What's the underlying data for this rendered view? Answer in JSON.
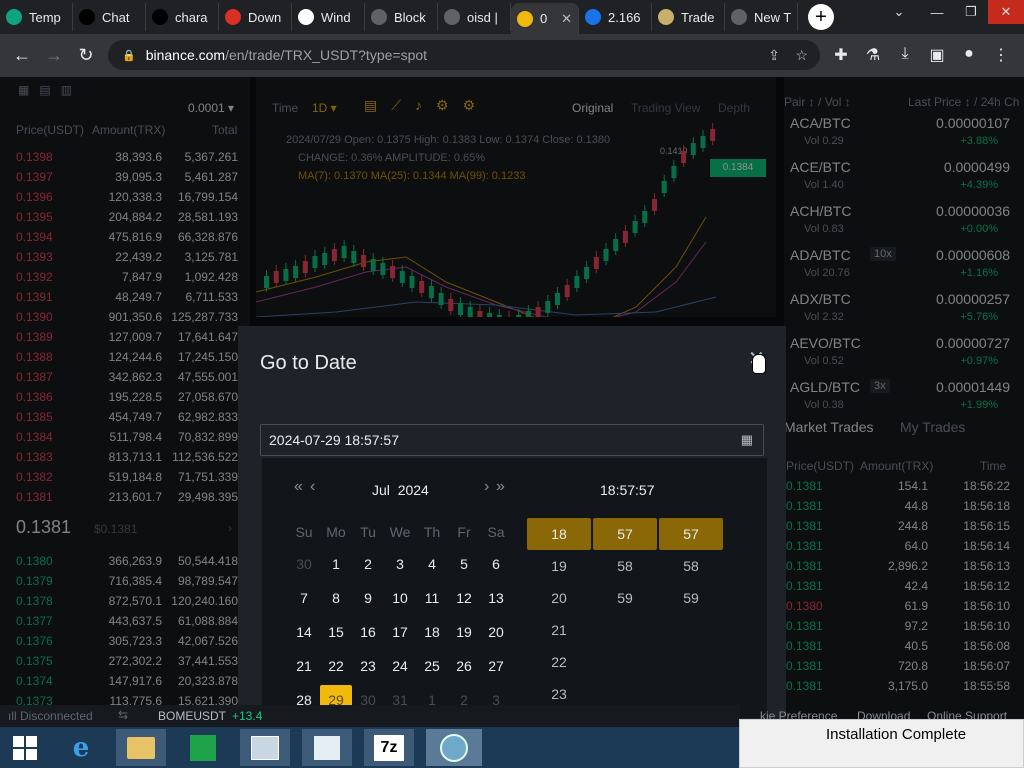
{
  "browser": {
    "tabs": [
      {
        "label": "Temp",
        "icon": "chatgpt-icon",
        "color": "#10a37f"
      },
      {
        "label": "Chat",
        "icon": "character-ai-icon",
        "color": "#000000"
      },
      {
        "label": "chara",
        "icon": "character-ai-icon",
        "color": "#000000"
      },
      {
        "label": "Down",
        "icon": "pdf-icon",
        "color": "#d93025"
      },
      {
        "label": "Wind",
        "icon": "windows-icon",
        "color": "#ffffff"
      },
      {
        "label": "Block",
        "icon": "globe-icon",
        "color": "#5f6368"
      },
      {
        "label": "oisd |",
        "icon": "globe-icon",
        "color": "#5f6368"
      },
      {
        "label": "0",
        "icon": "binance-icon",
        "color": "#f0b90b"
      },
      {
        "label": "2.166",
        "icon": "cloud-icon",
        "color": "#1a73e8"
      },
      {
        "label": "Trade",
        "icon": "trade-icon",
        "color": "#c8b06a"
      },
      {
        "label": "New T",
        "icon": "chrome-icon",
        "color": "#5f6368"
      }
    ],
    "url_host": "binance.com",
    "url_path": "/en/trade/TRX_USDT?type=spot"
  },
  "orderbook": {
    "precision": "0.0001",
    "headers": [
      "Price(USDT)",
      "Amount(TRX)",
      "Total"
    ],
    "asks": [
      [
        "0.1398",
        "38,393.6",
        "5,367.261"
      ],
      [
        "0.1397",
        "39,095.3",
        "5,461.287"
      ],
      [
        "0.1396",
        "120,338.3",
        "16,799.154"
      ],
      [
        "0.1395",
        "204,884.2",
        "28,581.193"
      ],
      [
        "0.1394",
        "475,816.9",
        "66,328.876"
      ],
      [
        "0.1393",
        "22,439.2",
        "3,125.781"
      ],
      [
        "0.1392",
        "7,847.9",
        "1,092.428"
      ],
      [
        "0.1391",
        "48,249.7",
        "6,711.533"
      ],
      [
        "0.1390",
        "901,350.6",
        "125,287.733"
      ],
      [
        "0.1389",
        "127,009.7",
        "17,641.647"
      ],
      [
        "0.1388",
        "124,244.6",
        "17,245.150"
      ],
      [
        "0.1387",
        "342,862.3",
        "47,555.001"
      ],
      [
        "0.1386",
        "195,228.5",
        "27,058.670"
      ],
      [
        "0.1385",
        "454,749.7",
        "62,982.833"
      ],
      [
        "0.1384",
        "511,798.4",
        "70,832.899"
      ],
      [
        "0.1383",
        "813,713.1",
        "112,536.522"
      ],
      [
        "0.1382",
        "519,184.8",
        "71,751.339"
      ],
      [
        "0.1381",
        "213,601.7",
        "29,498.395"
      ]
    ],
    "last_price": "0.1381",
    "last_usd": "$0.1381",
    "bids": [
      [
        "0.1380",
        "366,263.9",
        "50,544.418"
      ],
      [
        "0.1379",
        "716,385.4",
        "98,789.547"
      ],
      [
        "0.1378",
        "872,570.1",
        "120,240.160"
      ],
      [
        "0.1377",
        "443,637.5",
        "61,088.884"
      ],
      [
        "0.1376",
        "305,723.3",
        "42,067.526"
      ],
      [
        "0.1375",
        "272,302.2",
        "37,441.553"
      ],
      [
        "0.1374",
        "147,917.6",
        "20,323.878"
      ],
      [
        "0.1373",
        "113,775.6",
        "15,621.390"
      ]
    ]
  },
  "chart": {
    "time_label": "Time",
    "interval": "1D",
    "views": [
      "Original",
      "Trading View",
      "Depth"
    ],
    "ohlc": "2024/07/29  Open: 0.1375  High: 0.1383  Low: 0.1374  Close: 0.1380",
    "change": "CHANGE: 0.36%  AMPLITUDE: 0.65%",
    "ma": "MA(7): 0.1370  MA(25): 0.1344  MA(99): 0.1233",
    "current_price": "0.1384",
    "high_label": "0.1410"
  },
  "markets": {
    "headers": [
      "Pair",
      "Vol",
      "Last Price",
      "24h Ch"
    ],
    "rows": [
      {
        "pair": "ACA/BTC",
        "lev": "",
        "vol": "Vol 0.29",
        "price": "0.00000107",
        "chg": "+3.88%"
      },
      {
        "pair": "ACE/BTC",
        "lev": "",
        "vol": "Vol 1.40",
        "price": "0.0000499",
        "chg": "+4.39%"
      },
      {
        "pair": "ACH/BTC",
        "lev": "",
        "vol": "Vol 0.83",
        "price": "0.00000036",
        "chg": "+0.00%"
      },
      {
        "pair": "ADA/BTC",
        "lev": "10x",
        "vol": "Vol 20.76",
        "price": "0.00000608",
        "chg": "+1.16%"
      },
      {
        "pair": "ADX/BTC",
        "lev": "",
        "vol": "Vol 2.32",
        "price": "0.00000257",
        "chg": "+5.76%"
      },
      {
        "pair": "AEVO/BTC",
        "lev": "",
        "vol": "Vol 0.52",
        "price": "0.00000727",
        "chg": "+0.97%"
      },
      {
        "pair": "AGLD/BTC",
        "lev": "3x",
        "vol": "Vol 0.38",
        "price": "0.00001449",
        "chg": "+1.99%"
      }
    ]
  },
  "trades": {
    "tabs": [
      "Market Trades",
      "My Trades"
    ],
    "headers": [
      "Price(USDT)",
      "Amount(TRX)",
      "Time"
    ],
    "rows": [
      [
        "0.1381",
        "154.1",
        "18:56:22"
      ],
      [
        "0.1381",
        "44.8",
        "18:56:18"
      ],
      [
        "0.1381",
        "244.8",
        "18:56:15"
      ],
      [
        "0.1381",
        "64.0",
        "18:56:14"
      ],
      [
        "0.1381",
        "2,896.2",
        "18:56:13"
      ],
      [
        "0.1381",
        "42.4",
        "18:56:12"
      ],
      [
        "0.1380",
        "61.9",
        "18:56:10"
      ],
      [
        "0.1381",
        "97.2",
        "18:56:10"
      ],
      [
        "0.1381",
        "40.5",
        "18:56:08"
      ],
      [
        "0.1381",
        "720.8",
        "18:56:07"
      ],
      [
        "0.1381",
        "3,175.0",
        "18:55:58"
      ]
    ]
  },
  "status": {
    "connection": "Disconnected",
    "ticker": "BOMEUSDT",
    "ticker_chg": "+13.4",
    "links": [
      "kie Preference",
      "Download",
      "Online Support"
    ]
  },
  "modal": {
    "title": "Go to Date",
    "input_value": "2024-07-29 18:57:57",
    "month": "Jul",
    "year": "2024",
    "time_header": "18:57:57",
    "weekdays": [
      "Su",
      "Mo",
      "Tu",
      "We",
      "Th",
      "Fr",
      "Sa"
    ],
    "days": [
      [
        "30",
        "o"
      ],
      [
        "1",
        ""
      ],
      [
        "2",
        ""
      ],
      [
        "3",
        ""
      ],
      [
        "4",
        ""
      ],
      [
        "5",
        ""
      ],
      [
        "6",
        ""
      ],
      [
        "7",
        ""
      ],
      [
        "8",
        ""
      ],
      [
        "9",
        ""
      ],
      [
        "10",
        ""
      ],
      [
        "11",
        ""
      ],
      [
        "12",
        ""
      ],
      [
        "13",
        ""
      ],
      [
        "14",
        ""
      ],
      [
        "15",
        ""
      ],
      [
        "16",
        ""
      ],
      [
        "17",
        ""
      ],
      [
        "18",
        ""
      ],
      [
        "19",
        ""
      ],
      [
        "20",
        ""
      ],
      [
        "21",
        ""
      ],
      [
        "22",
        ""
      ],
      [
        "23",
        ""
      ],
      [
        "24",
        ""
      ],
      [
        "25",
        ""
      ],
      [
        "26",
        ""
      ],
      [
        "27",
        ""
      ],
      [
        "28",
        ""
      ],
      [
        "29",
        "sel"
      ],
      [
        "30",
        "o"
      ],
      [
        "31",
        "o"
      ],
      [
        "1",
        "o"
      ],
      [
        "2",
        "o"
      ],
      [
        "3",
        "o"
      ]
    ],
    "hours": [
      "18",
      "19",
      "20",
      "21",
      "22",
      "23"
    ],
    "minutes": [
      "57",
      "58",
      "59"
    ],
    "seconds": [
      "57",
      "58",
      "59"
    ]
  },
  "notification": {
    "title": "Installation Complete"
  },
  "colors": {
    "ask": "#f6465d",
    "bid": "#0ecb81",
    "accent": "#f0b90b"
  }
}
